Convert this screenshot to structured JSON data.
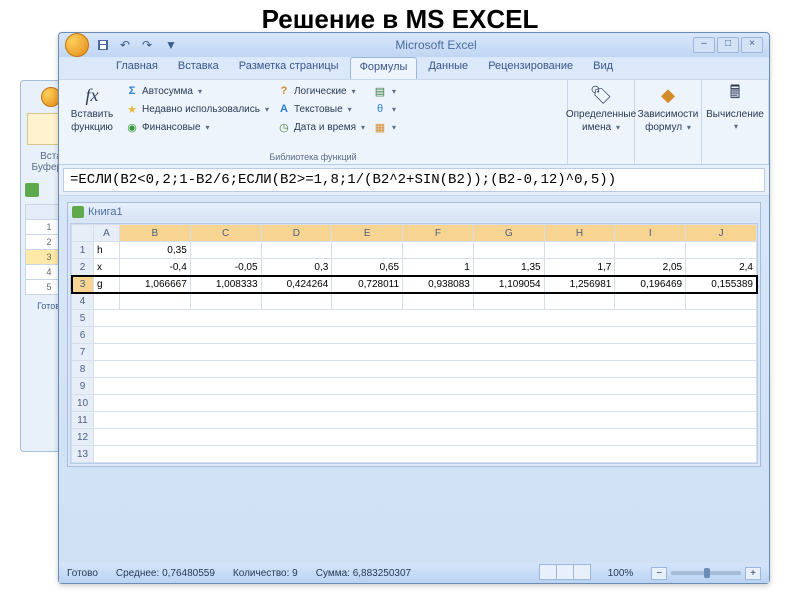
{
  "page_title": "Решение в MS EXCEL",
  "app_name": "Microsoft Excel",
  "tabs": {
    "home": "Главная",
    "insert": "Вставка",
    "layout": "Разметка страницы",
    "formulas": "Формулы",
    "data": "Данные",
    "review": "Рецензирование",
    "view": "Вид"
  },
  "ribbon": {
    "insert_fn_top": "Вставить",
    "insert_fn_bot": "функцию",
    "autosum": "Автосумма",
    "recent": "Недавно использовались",
    "financial": "Финансовые",
    "logical": "Логические",
    "text": "Текстовые",
    "datetime": "Дата и время",
    "library_label": "Библиотека функций",
    "names_top": "Определенные",
    "names_bot": "имена",
    "deps_top": "Зависимости",
    "deps_bot": "формул",
    "calc": "Вычисление"
  },
  "formula": "=ЕСЛИ(B2<0,2;1-B2/6;ЕСЛИ(B2>=1,8;1/(B2^2+SIN(B2));(B2-0,12)^0,5))",
  "workbook": "Книга1",
  "columns": [
    "A",
    "B",
    "C",
    "D",
    "E",
    "F",
    "G",
    "H",
    "I",
    "J"
  ],
  "rows": [
    "1",
    "2",
    "3",
    "4",
    "5",
    "6",
    "7",
    "8",
    "9",
    "10",
    "11",
    "12",
    "13"
  ],
  "cells": {
    "r1": [
      "h",
      "0,35",
      "",
      "",
      "",
      "",
      "",
      "",
      "",
      ""
    ],
    "r2": [
      "x",
      "-0,4",
      "-0,05",
      "0,3",
      "0,65",
      "1",
      "1,35",
      "1,7",
      "2,05",
      "2,4"
    ],
    "r3": [
      "g",
      "1,066667",
      "1,008333",
      "0,424264",
      "0,728011",
      "0,938083",
      "1,109054",
      "1,256981",
      "0,196469",
      "0,155389"
    ]
  },
  "status": {
    "ready": "Готово",
    "avg_lbl": "Среднее:",
    "avg": "0,76480559",
    "count_lbl": "Количество:",
    "count": "9",
    "sum_lbl": "Сумма:",
    "sum": "6,883250307",
    "zoom": "100%"
  },
  "bg": {
    "insert": "Вста",
    "buffer": "Буфер о",
    "ready": "Готово"
  }
}
